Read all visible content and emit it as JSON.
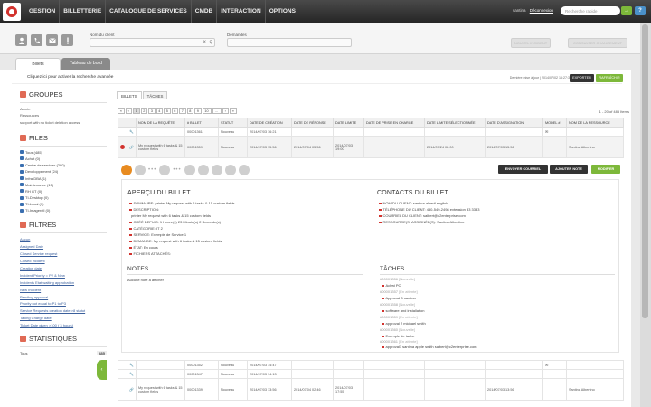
{
  "nav": [
    "GESTION",
    "BILLETTERIE",
    "CATALOGUE DE SERVICES",
    "CMDB",
    "INTERACTION",
    "OPTIONS"
  ],
  "user": {
    "name": "santina",
    "logout": "Déconnexion"
  },
  "search": {
    "placeholder": "Recherche rapide",
    "go": "→",
    "help": "?"
  },
  "toolbar": {
    "client_label": "Nom du client",
    "requests_label": "Demandes",
    "btn1": "NOUVEL INCIDENT",
    "btn2": "CONSULTER CHANGEMENT"
  },
  "tabs": {
    "billets": "Billets",
    "dashboard": "Tableau de bord"
  },
  "message": {
    "text": "Cliquez ici pour activer la recherche avancée",
    "last_update": "Dernière mise à jour | 2014/07/02 16:27:33",
    "export": "EXPORTER",
    "refresh": "RAFRAÎCHIR"
  },
  "sidebar": {
    "groups_title": "GROUPES",
    "groups": [
      "Admin",
      "Ressources",
      "support with no ticket deletion access"
    ],
    "files_title": "FILES",
    "files": [
      "Tous (485)",
      "Achat (0)",
      "Centre de services (290)",
      "Developpement (24)",
      "Infra-DBA (1)",
      "Maintenance (15)",
      "RH GT (0)",
      "TI-Desktop (0)",
      "TI-Local (1)",
      "TI-Imagerell (0)"
    ],
    "filters_title": "FILTRES",
    "filters": [
      "Aucun",
      "Assigned Date",
      "Closed Service request",
      "Closed Incident",
      "Creation date",
      "Incident Priority = P2 & New",
      "Incidents Etat waiting approbation",
      "New Incident",
      "Pending approval",
      "Priority not equal to P1 to P3",
      "Service Requests creation date >8 statut",
      "Taking Charge date",
      "Ticket Date given >100 ( 3 hours)"
    ],
    "stats_title": "STATISTIQUES",
    "stats_label": "Tous",
    "stats_value": "485"
  },
  "content": {
    "subtabs": [
      "BILLETS",
      "TÂCHES"
    ],
    "pages": [
      "«",
      "‹",
      "1",
      "2",
      "3",
      "4",
      "5",
      "6",
      "7",
      "8",
      "9",
      "10",
      "...",
      "›",
      "»"
    ],
    "count": "1 - 20 of 485 Items",
    "headers": [
      "",
      "",
      "NOM DE LA REQUÊTE",
      "# BILLET",
      "STATUT",
      "DATE DE CRÉATION",
      "DATE DE RÉPONSE",
      "DATE LIMITE",
      "DATE DE PRISE EN CHARGE",
      "DATE LIMITE SÉLECTIONNÉE",
      "DATE D'ASSIGNATION",
      "MODEL #",
      "NOM DE LA RESSOURCE"
    ],
    "rows": [
      {
        "name": "",
        "id": "00001361",
        "status": "Nouveau",
        "created": "2014/07/03 16:21",
        "response": "",
        "limit": "",
        "taken": "",
        "selected": "",
        "assigned": "",
        "resource": ""
      },
      {
        "name": "My request with 6 tasks & 15 custom fields",
        "id": "00001359",
        "status": "Nouveau",
        "created": "2014/07/03 15:56",
        "response": "2014/07/04 05:56",
        "limit": "2014/07/03 19:00",
        "taken": "",
        "selected": "2014/07/24 02:00",
        "assigned": "2014/07/03 15:56",
        "resource": "Santina Albertino"
      }
    ],
    "actions": {
      "send": "ENVOYER COURRIEL",
      "note": "AJOUTER NOTE",
      "modify": "MODIFIER"
    }
  },
  "detail": {
    "apercu_title": "APERÇU DU BILLET",
    "apercu": [
      "SOMMAIRE: printer My request with 6 tasks & 15 custom fields",
      "DESCRIPTION:",
      "printer My request with 6 tasks & 15 custom fields",
      "CRÉÉ DEPUIS: 1 Heure(s) 23 Minute(s) 2 Seconde(s)",
      "CATÉGORIE: IT 2",
      "SERVICE: Exemple de Service 1",
      "DEMANDE: My request with 6 tasks & 15 custom fields",
      "ÉTAT: En cours",
      "FICHIERS ATTACHÉS:"
    ],
    "contacts_title": "CONTACTS DU BILLET",
    "contacts": [
      "NOM DU CLIENT: santina albertl english",
      "TÉLÉPHONE DU CLIENT: 450-549-2498 extension 33 3333",
      "COURRIEL DU CLIENT: salbert@c2enterprise.com",
      "RESSOURCE(S) ASSIGNÉE(S): Santina Albertino"
    ],
    "notes_title": "NOTES",
    "notes_empty": "Aucune note à afficher",
    "tasks_title": "TÂCHES",
    "tasks": [
      {
        "id": "#00001356",
        "status": "[Nouvelle]",
        "desc": "Achat PC"
      },
      {
        "id": "#00001357",
        "status": "[En attente]",
        "desc": "Approval 3 santina"
      },
      {
        "id": "#00001358",
        "status": "[Nouvelle]",
        "desc": "software and installation"
      },
      {
        "id": "#00001359",
        "status": "[En attente]",
        "desc": "approval 2 michael smith"
      },
      {
        "id": "#00001360",
        "status": "[Nouvelle]",
        "desc": "Exemple de tache"
      },
      {
        "id": "#00001361",
        "status": "[En attente]",
        "desc": "approval1 santina apple smith salbert@c2enterprise.com"
      }
    ]
  },
  "lower_rows": [
    {
      "name": "",
      "id": "00001352",
      "status": "Nouveau",
      "created": "2014/07/03 14:47",
      "response": "",
      "limit": "",
      "assigned": "",
      "resource": ""
    },
    {
      "name": "",
      "id": "00001347",
      "status": "Nouveau",
      "created": "2014/07/03 14:13",
      "response": "",
      "limit": "",
      "assigned": "",
      "resource": ""
    },
    {
      "name": "My request with 6 tasks & 15 custom fields",
      "id": "00001339",
      "status": "Nouveau",
      "created": "2014/07/03 13:56",
      "response": "2014/07/04 02:46",
      "limit": "2014/07/03 17:55",
      "assigned": "2014/07/03 13:56",
      "resource": "Santina Albertino"
    }
  ]
}
